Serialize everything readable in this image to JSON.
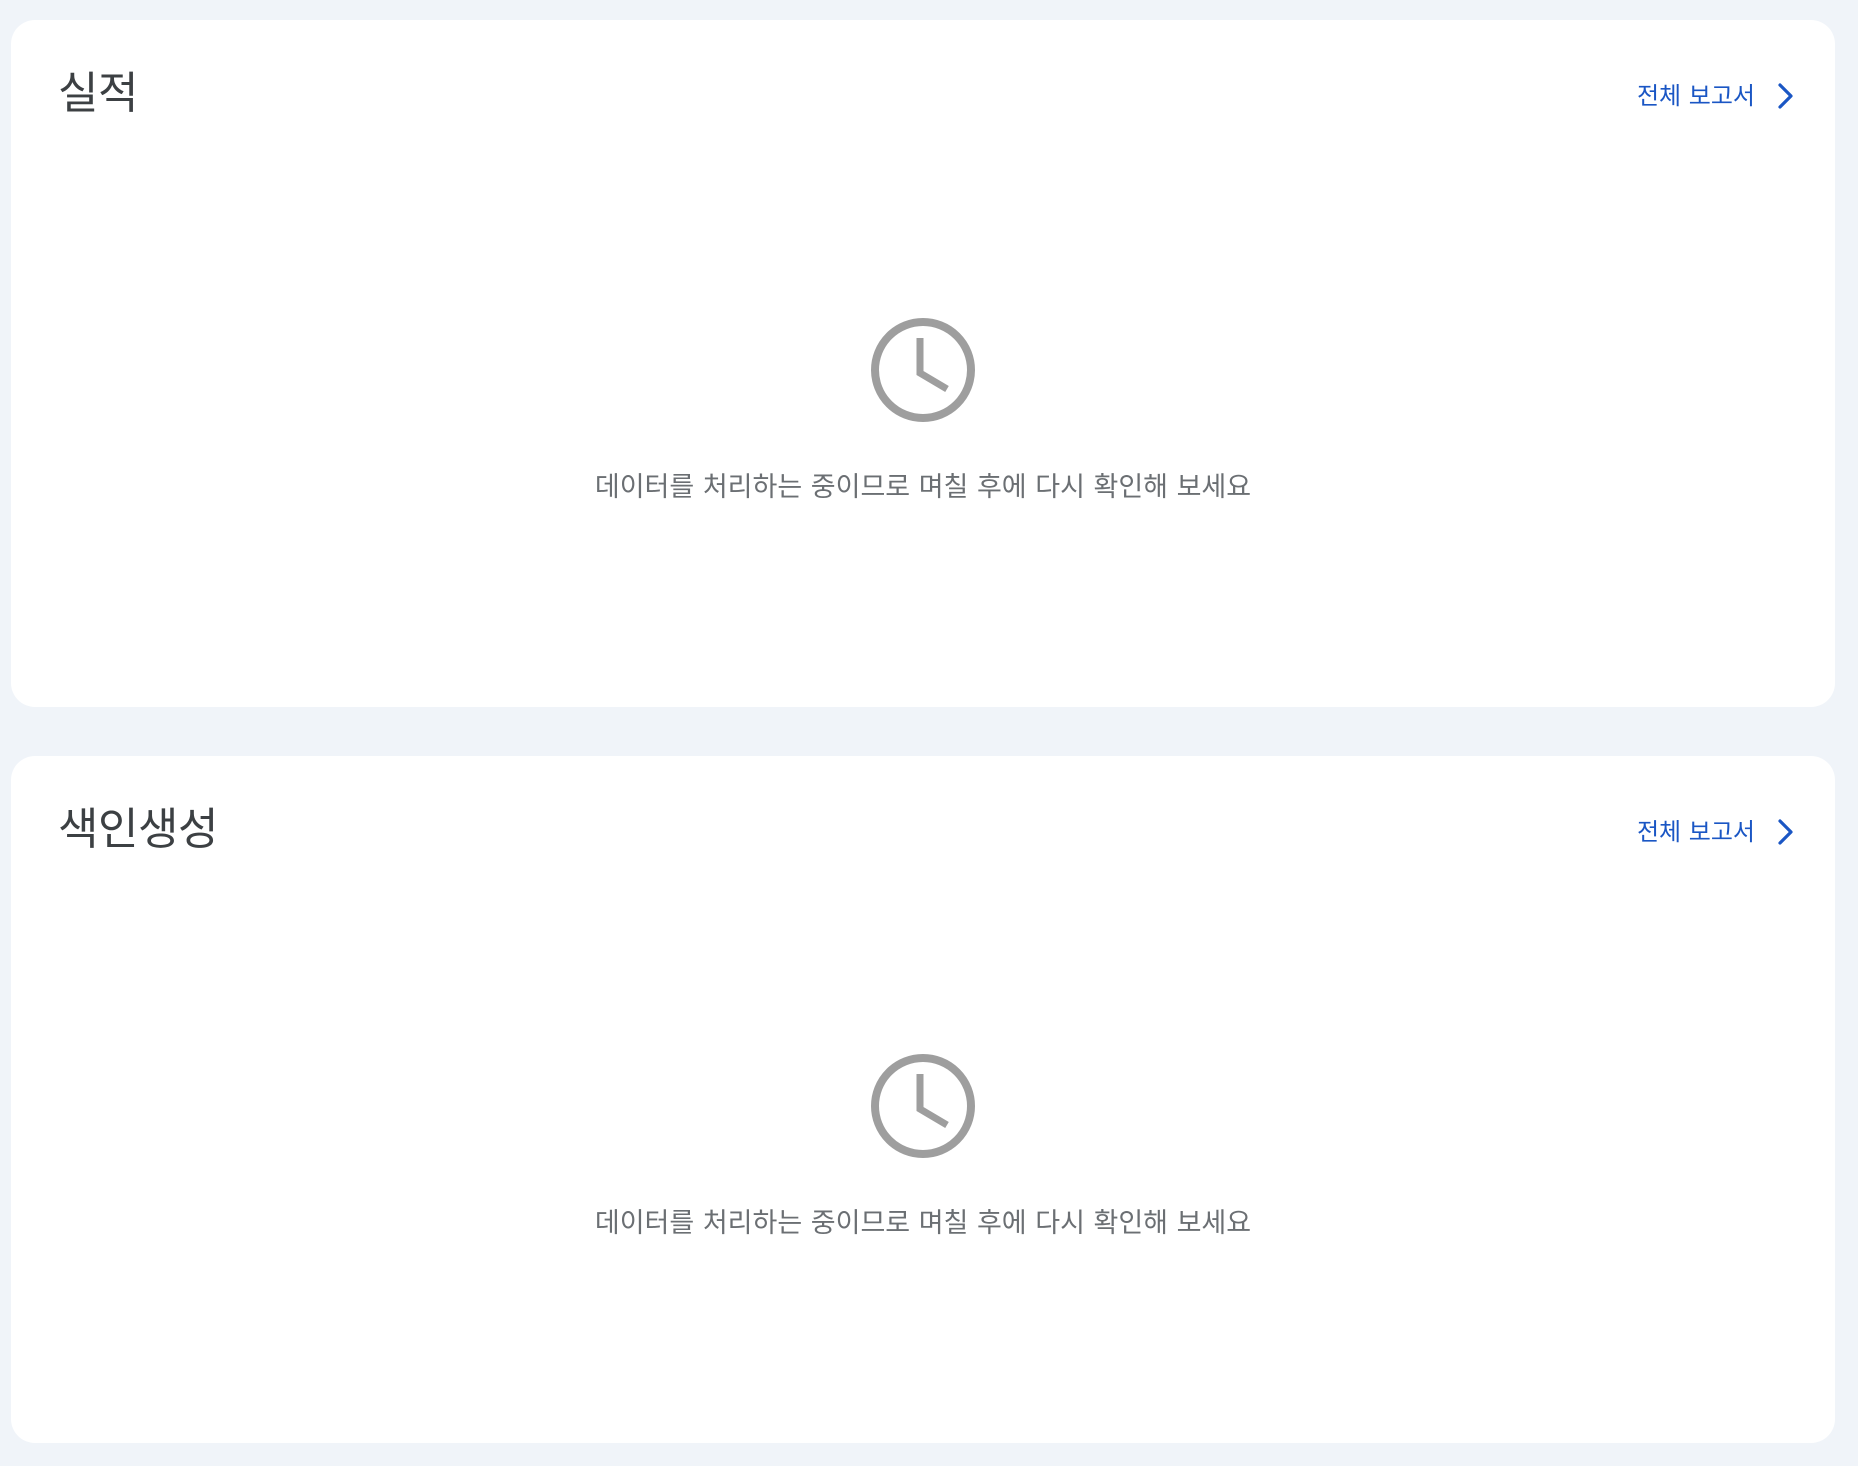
{
  "sections": [
    {
      "title": "실적",
      "link_label": "전체 보고서",
      "empty_message": "데이터를 처리하는 중이므로 며칠 후에 다시 확인해 보세요",
      "empty_icon": "clock-icon"
    },
    {
      "title": "색인생성",
      "link_label": "전체 보고서",
      "empty_message": "데이터를 처리하는 중이므로 며칠 후에 다시 확인해 보세요",
      "empty_icon": "clock-icon"
    }
  ],
  "colors": {
    "page_background": "#f0f4f9",
    "card_background": "#ffffff",
    "title": "#3c4043",
    "link": "#1a56c4",
    "muted_text": "#6b6f73",
    "icon": "#9e9e9e"
  }
}
